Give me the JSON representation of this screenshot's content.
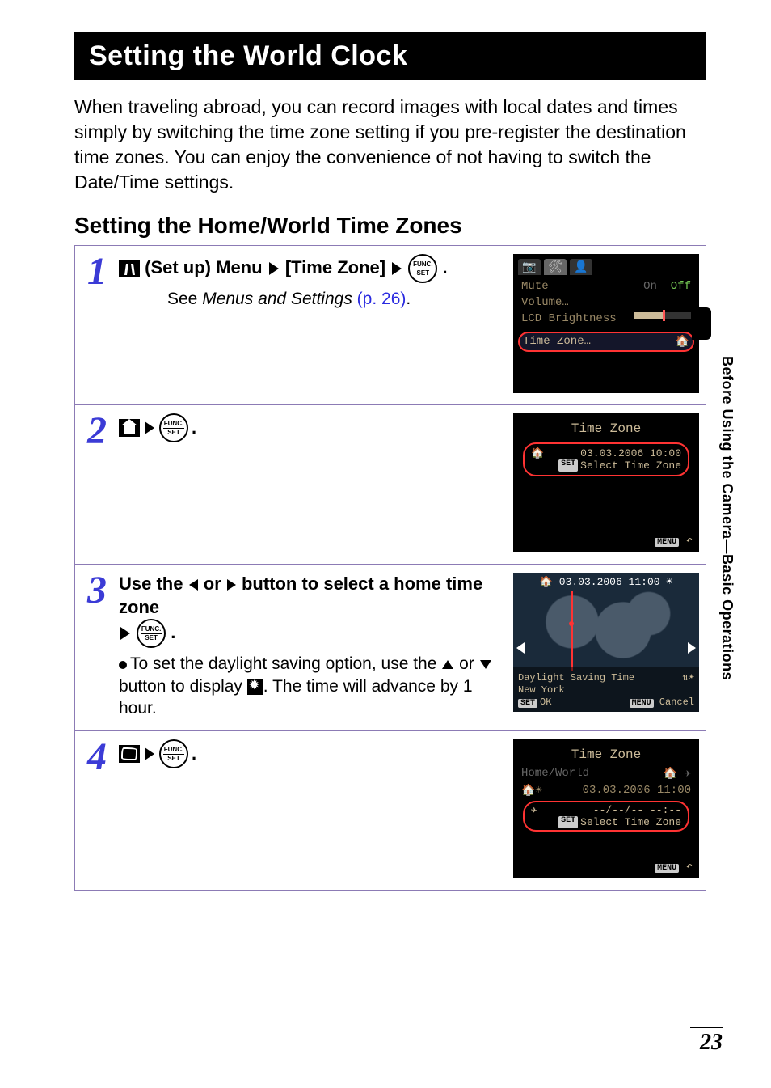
{
  "page": {
    "title": "Setting the World Clock",
    "intro": "When traveling abroad, you can record images with local dates and times simply by switching the time zone setting if you pre-register the destination time zones. You can enjoy the convenience of not having to switch the Date/Time settings.",
    "subhead": "Setting the Home/World Time Zones",
    "side_text": "Before Using the Camera—Basic Operations",
    "page_number": "23"
  },
  "steps": [
    {
      "num": "1",
      "head_prefix": "(Set up) Menu",
      "head_mid": "[Time Zone]",
      "head_suffix": ".",
      "see_prefix": "See ",
      "see_em": "Menus and Settings",
      "see_link": "(p. 26)",
      "see_suffix": ".",
      "screen": {
        "mute_label": "Mute",
        "mute_on": "On",
        "mute_off": "Off",
        "volume_label": "Volume…",
        "lcd_label": "LCD Brightness",
        "tz_label": "Time Zone…"
      }
    },
    {
      "num": "2",
      "head_suffix": ".",
      "screen": {
        "title": "Time Zone",
        "datetime": "03.03.2006 10:00",
        "select_label": "Select Time Zone",
        "menu_label": "MENU"
      }
    },
    {
      "num": "3",
      "head_line1": "Use the ",
      "head_line2": " or ",
      "head_line3": " button to select a home time zone",
      "head_suffix": ".",
      "body_prefix": "To set the daylight saving option, use the ",
      "body_mid": " or ",
      "body_after": " button to display ",
      "body_end": ". The time will advance by 1 hour.",
      "screen": {
        "top_datetime": "03.03.2006 11:00",
        "dst_label": "Daylight Saving Time",
        "city": "New York",
        "ok_label": "OK",
        "cancel_label": "Cancel",
        "menu_label": "MENU",
        "set_label": "SET"
      }
    },
    {
      "num": "4",
      "head_suffix": ".",
      "screen": {
        "title": "Time Zone",
        "hw_label": "Home/World",
        "home_datetime": "03.03.2006 11:00",
        "world_datetime": "--/--/-- --:--",
        "select_label": "Select Time Zone",
        "menu_label": "MENU",
        "set_label": "SET"
      }
    }
  ]
}
